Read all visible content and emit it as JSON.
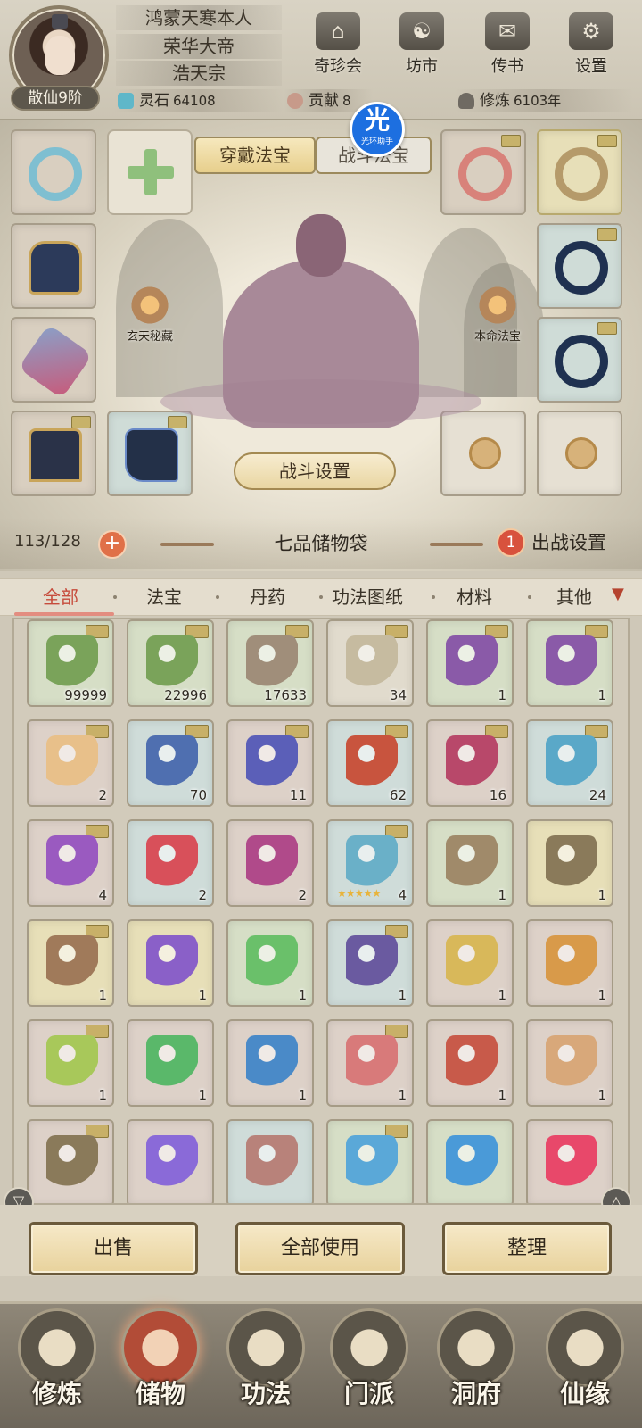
{
  "player": {
    "name": "鸿蒙天寒本人",
    "title": "荣华大帝",
    "sect": "浩天宗",
    "rank": "散仙9阶"
  },
  "top_buttons": [
    {
      "label": "奇珍会",
      "icon": "pavilion-icon"
    },
    {
      "label": "坊市",
      "icon": "market-icon"
    },
    {
      "label": "传书",
      "icon": "scroll-icon"
    },
    {
      "label": "设置",
      "icon": "gear-icon"
    }
  ],
  "resources": [
    {
      "label": "灵石",
      "value": "64108",
      "icon": "spirit-stone-icon",
      "color": "#5fb7c9"
    },
    {
      "label": "贡献",
      "value": "8",
      "icon": "contribution-icon",
      "color": "#c79a8a"
    },
    {
      "label": "修炼",
      "value": "6103年",
      "icon": "cultivation-icon",
      "color": "#6f6a62"
    }
  ],
  "helper_badge": {
    "big": "光",
    "small": "光环助手"
  },
  "equip_tabs": {
    "wear": "穿戴法宝",
    "battle": "战斗法宝"
  },
  "side_features": {
    "left": "玄天秘藏",
    "right": "本命法宝"
  },
  "battle_settings_label": "战斗设置",
  "bag": {
    "capacity": "113/128",
    "expand_symbol": "+",
    "name": "七品储物袋",
    "sortie_count": "1",
    "sortie_label": "出战设置"
  },
  "categories": [
    "全部",
    "法宝",
    "丹药",
    "功法图纸",
    "材料",
    "其他"
  ],
  "active_category": "全部",
  "items": [
    {
      "name": "herb-icon",
      "qty": "99999",
      "color": "#d6dec6",
      "icon_color": "#7aa35a"
    },
    {
      "name": "herb-icon",
      "qty": "22996",
      "color": "#d6dec6",
      "icon_color": "#7aa35a"
    },
    {
      "name": "ore-icon",
      "qty": "17633",
      "color": "#d6dec6",
      "icon_color": "#a08e7a"
    },
    {
      "name": "array-scroll-icon",
      "qty": "34",
      "color": "#e1dbcd",
      "icon_color": "#c6bba0"
    },
    {
      "name": "grape-cloth-icon",
      "qty": "1",
      "color": "#d6dec6",
      "icon_color": "#8a5aa8"
    },
    {
      "name": "grape-cloth-icon",
      "qty": "1",
      "color": "#d6dec6",
      "icon_color": "#8a5aa8"
    },
    {
      "name": "vase-icon",
      "qty": "2",
      "color": "#ddd1c8",
      "icon_color": "#e8c08a"
    },
    {
      "name": "blue-flower-icon",
      "qty": "70",
      "color": "#cfdcd9",
      "icon_color": "#4f6fb0"
    },
    {
      "name": "blue-flower-icon",
      "qty": "11",
      "color": "#ddd1c8",
      "icon_color": "#5b5fb8"
    },
    {
      "name": "fire-cactus-icon",
      "qty": "62",
      "color": "#cfdcd9",
      "icon_color": "#c8543e"
    },
    {
      "name": "fire-cactus-icon",
      "qty": "16",
      "color": "#ddd1c8",
      "icon_color": "#b8486a"
    },
    {
      "name": "crystal-flower-icon",
      "qty": "24",
      "color": "#cfdcd9",
      "icon_color": "#5aa8c8"
    },
    {
      "name": "crystal-flower-icon",
      "qty": "4",
      "color": "#ddd1c8",
      "icon_color": "#9a5ac0"
    },
    {
      "name": "spiky-fruit-icon",
      "qty": "2",
      "color": "#cfdcd9",
      "icon_color": "#d8505a"
    },
    {
      "name": "spiky-fruit-icon",
      "qty": "2",
      "color": "#ddd1c8",
      "icon_color": "#b04a8a"
    },
    {
      "name": "star-cloth-icon",
      "qty": "4",
      "color": "#cfdcd9",
      "icon_color": "#6ab0c8",
      "stars": "★★★★★"
    },
    {
      "name": "ring-icon",
      "qty": "1",
      "color": "#d6dec6",
      "icon_color": "#a08a6a"
    },
    {
      "name": "dagger-icon",
      "qty": "1",
      "color": "#e7dfb8",
      "icon_color": "#8a7a5a"
    },
    {
      "name": "flute-icon",
      "qty": "1",
      "color": "#e7dfb8",
      "icon_color": "#a07a5a"
    },
    {
      "name": "purple-ore-icon",
      "qty": "1",
      "color": "#e7dfb8",
      "icon_color": "#8a60c8"
    },
    {
      "name": "green-orb-icon",
      "qty": "1",
      "color": "#d6dec6",
      "icon_color": "#6ac06a"
    },
    {
      "name": "spear-icon",
      "qty": "1",
      "color": "#cfdcd9",
      "icon_color": "#6a5aa0"
    },
    {
      "name": "sword-icon",
      "qty": "1",
      "color": "#ddd1c8",
      "icon_color": "#d8b85a"
    },
    {
      "name": "bracelet-icon",
      "qty": "1",
      "color": "#ddd1c8",
      "icon_color": "#d89a4a"
    },
    {
      "name": "jade-sword-icon",
      "qty": "1",
      "color": "#ddd1c8",
      "icon_color": "#a8c85a"
    },
    {
      "name": "green-blade-icon",
      "qty": "1",
      "color": "#ddd1c8",
      "icon_color": "#5ab86a"
    },
    {
      "name": "blue-sword-icon",
      "qty": "1",
      "color": "#ddd1c8",
      "icon_color": "#4a8ac8"
    },
    {
      "name": "pink-cloud-icon",
      "qty": "1",
      "color": "#ddd1c8",
      "icon_color": "#d87a7a"
    },
    {
      "name": "axe-icon",
      "qty": "1",
      "color": "#ddd1c8",
      "icon_color": "#c85a4a"
    },
    {
      "name": "ornate-sword-icon",
      "qty": "1",
      "color": "#ddd1c8",
      "icon_color": "#d8a87a"
    },
    {
      "name": "cauldron-icon",
      "qty": "",
      "color": "#ddd1c8",
      "icon_color": "#8a7a5a"
    },
    {
      "name": "purple-ring-icon",
      "qty": "",
      "color": "#ddd1c8",
      "icon_color": "#8a6ad8"
    },
    {
      "name": "sand-icon",
      "qty": "",
      "color": "#cfdcd9",
      "icon_color": "#b8827a"
    },
    {
      "name": "water-drop-icon",
      "qty": "",
      "color": "#d6dec6",
      "icon_color": "#5aa8d8"
    },
    {
      "name": "wave-icon",
      "qty": "",
      "color": "#d6dec6",
      "icon_color": "#4a9ad8"
    },
    {
      "name": "red-orb-icon",
      "qty": "",
      "color": "#ddd1c8",
      "icon_color": "#e8486a"
    }
  ],
  "actions": {
    "sell": "出售",
    "use_all": "全部使用",
    "sort": "整理"
  },
  "bottom_nav": [
    {
      "label": "修炼",
      "icon": "cultivate-icon"
    },
    {
      "label": "储物",
      "icon": "storage-bag-icon"
    },
    {
      "label": "功法",
      "icon": "technique-icon"
    },
    {
      "label": "门派",
      "icon": "sect-icon"
    },
    {
      "label": "洞府",
      "icon": "cave-icon"
    },
    {
      "label": "仙缘",
      "icon": "immortal-fate-icon"
    }
  ]
}
